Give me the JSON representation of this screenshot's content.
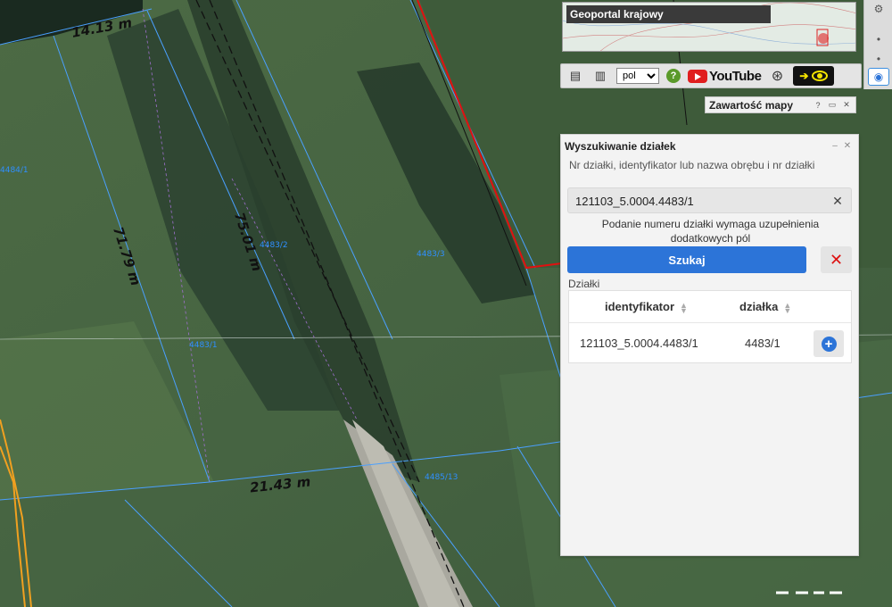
{
  "map": {
    "measurements": [
      "14.13 m",
      "71.79 m",
      "75.01 m",
      "21.43 m"
    ],
    "parcel_labels": [
      "4484/1",
      "4483/2",
      "4483/3",
      "4483/1",
      "4485/13"
    ]
  },
  "overview": {
    "title": "Geoportal krajowy"
  },
  "toolbar": {
    "language": "pol",
    "language_options": [
      "pol"
    ],
    "help": "?",
    "youtube_label": "YouTube"
  },
  "layers_panel": {
    "title": "Zawartość mapy",
    "help": "?"
  },
  "search_panel": {
    "title": "Wyszukiwanie działek",
    "hint": "Nr działki, identyfikator lub nazwa obrębu i nr działki",
    "input_value": "121103_5.0004.4483/1",
    "warning": "Podanie numeru działki wymaga uzupełnienia dodatkowych pól",
    "search_label": "Szukaj",
    "results_section": "Działki",
    "columns": [
      "identyfikator",
      "działka"
    ],
    "rows": [
      {
        "identyfikator": "121103_5.0004.4483/1",
        "dzialka": "4483/1"
      }
    ]
  },
  "colors": {
    "accent": "#2c74d8",
    "parcel_line": "#4aa0ff",
    "boundary": "#e01010",
    "route": "#f0a020"
  },
  "icons": {
    "toolbar": [
      "list-icon",
      "gml-icon",
      "help-icon",
      "youtube-icon",
      "steering-wheel-icon",
      "eye-icon"
    ],
    "right_tools": [
      "gear-icon",
      "dot-icon",
      "dot-icon",
      "eye-icon"
    ]
  }
}
